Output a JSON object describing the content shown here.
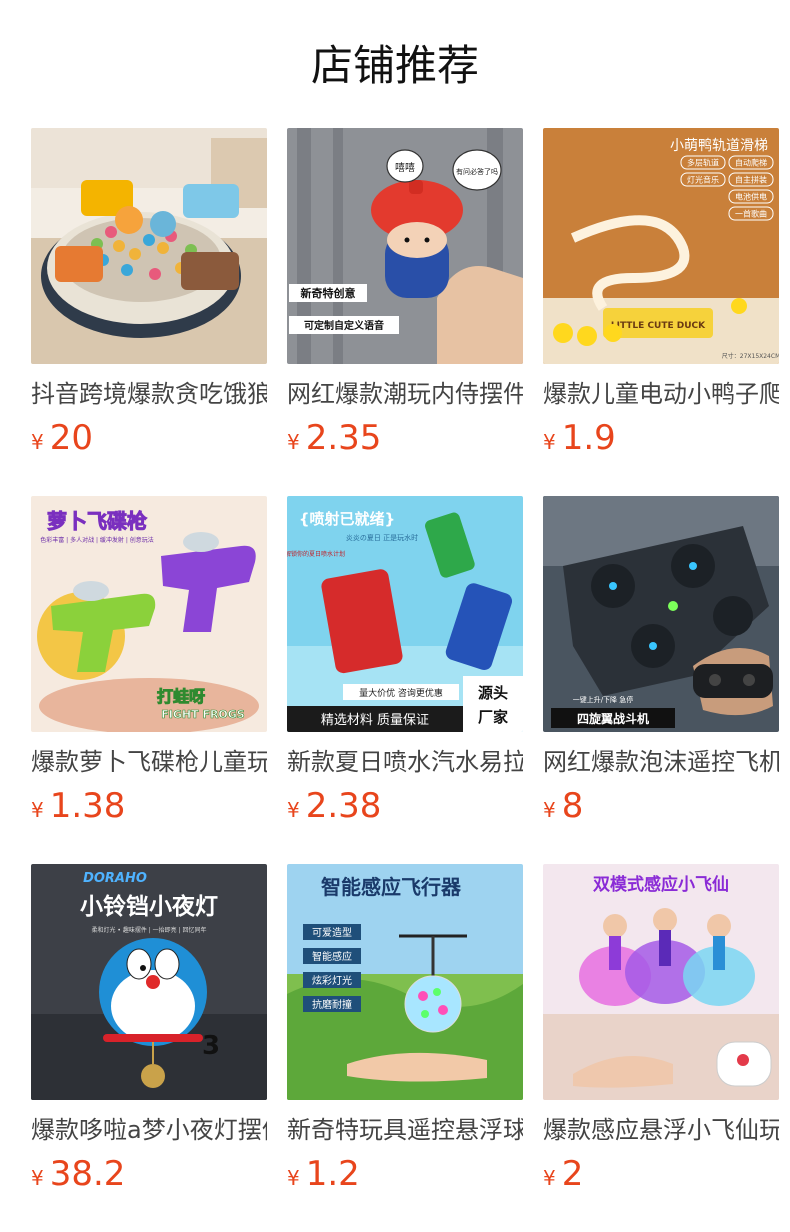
{
  "page": {
    "title": "店铺推荐"
  },
  "colors": {
    "price": "#e8451c",
    "title": "#111111"
  },
  "products": [
    {
      "name": "抖音跨境爆款贪吃饿狼",
      "currency": "¥",
      "price": "20",
      "image": {
        "icon": "hungry-animal-game-image"
      }
    },
    {
      "name": "网红爆款潮玩内侍摆件",
      "currency": "¥",
      "price": "2.35",
      "image": {
        "icon": "talking-figure-image",
        "bubble1": "嘻嘻",
        "bubble2": "有问必答了吗",
        "tag1": "新奇特创意",
        "tag2": "可定制自定义语音"
      }
    },
    {
      "name": "爆款儿童电动小鸭子爬楼梯",
      "currency": "¥",
      "price": "1.9",
      "image": {
        "icon": "duck-slide-image",
        "headline": "小萌鸭轨道滑梯",
        "features": [
          "多层轨道",
          "自动爬梯",
          "灯光音乐",
          "自主拼装",
          "电池供电",
          "一首歌曲"
        ],
        "size": "尺寸：27X15X24CM",
        "box_text": "LITTLE CUTE DUCK"
      }
    },
    {
      "name": "爆款萝卜飞碟枪儿童玩具",
      "currency": "¥",
      "price": "1.38",
      "image": {
        "icon": "ufo-gun-image",
        "headline": "萝卜飞碟枪",
        "subline": "色彩丰富 | 多人对战 | 缓冲发射 | 创意玩法",
        "brand": "打蛙呀",
        "brand_en": "FIGHT FROGS"
      }
    },
    {
      "name": "新款夏日喷水汽水易拉罐",
      "currency": "¥",
      "price": "2.38",
      "image": {
        "icon": "soda-water-gun-image",
        "headline": "{喷射已就绪}",
        "subline": "炎炎の夏日 正是玩水时",
        "side": "解锁你的夏日喷水计划",
        "bar1": "精选材料 质量保证",
        "bar2": "量大价优 咨询更优惠",
        "corner1": "源头",
        "corner2": "厂家"
      }
    },
    {
      "name": "网红爆款泡沫遥控飞机",
      "currency": "¥",
      "price": "8",
      "image": {
        "icon": "fighter-drone-image",
        "caption": "四旋翼战斗机",
        "small": "一键上升/下降 急停"
      }
    },
    {
      "name": "爆款哆啦a梦小夜灯摆件",
      "currency": "¥",
      "price": "38.2",
      "image": {
        "icon": "doraemon-lamp-image",
        "brand": "DORAHO",
        "headline": "小铃铛小夜灯",
        "subline": "柔和灯光 • 趣味摆件 | 一抬即亮 | 回忆同年"
      }
    },
    {
      "name": "新奇特玩具遥控悬浮球",
      "currency": "¥",
      "price": "1.2",
      "image": {
        "icon": "flying-ball-image",
        "headline": "智能感应飞行器",
        "features": [
          "可爱造型",
          "智能感应",
          "炫彩灯光",
          "抗磨耐撞"
        ]
      }
    },
    {
      "name": "爆款感应悬浮小飞仙玩具",
      "currency": "¥",
      "price": "2",
      "image": {
        "icon": "flying-fairy-image",
        "headline": "双模式感应小飞仙"
      }
    }
  ]
}
